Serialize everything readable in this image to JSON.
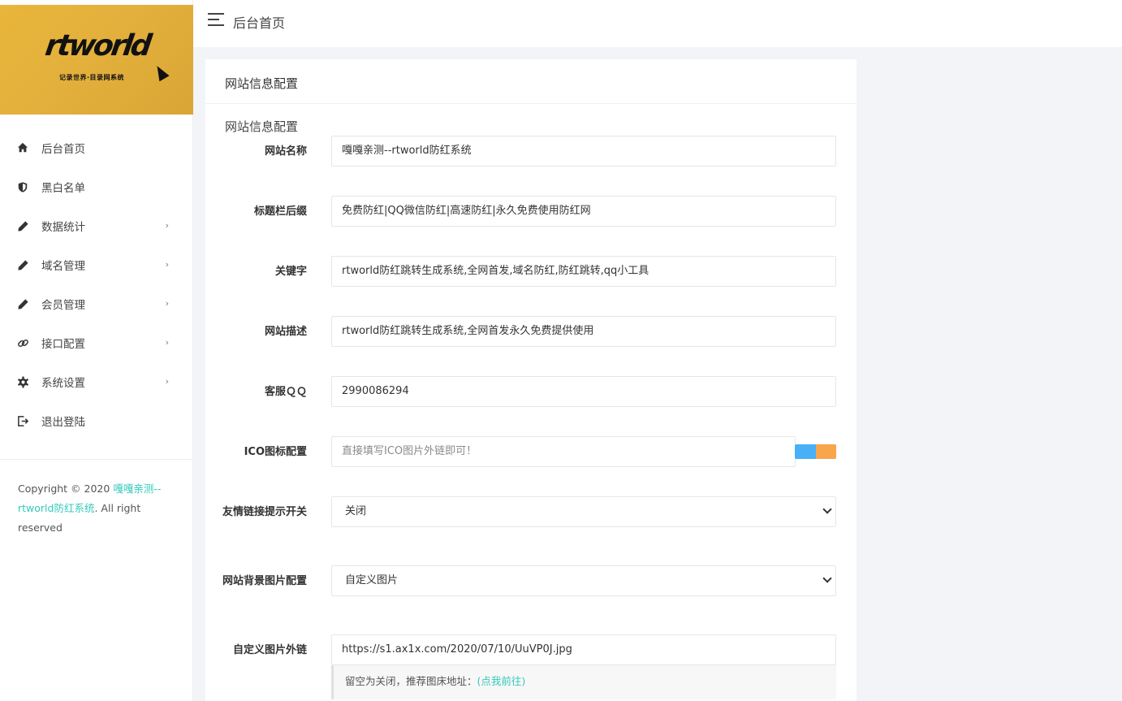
{
  "logo": {
    "title": "rtworld",
    "subtitle": "记录世界·目录网系统"
  },
  "sidebar": {
    "items": [
      {
        "label": "后台首页",
        "icon": "home-icon",
        "has_submenu": false
      },
      {
        "label": "黑白名单",
        "icon": "shield-icon",
        "has_submenu": false
      },
      {
        "label": "数据统计",
        "icon": "pencil-icon",
        "has_submenu": true
      },
      {
        "label": "域名管理",
        "icon": "pencil-icon",
        "has_submenu": true
      },
      {
        "label": "会员管理",
        "icon": "pencil-icon",
        "has_submenu": true
      },
      {
        "label": "接口配置",
        "icon": "link-icon",
        "has_submenu": true
      },
      {
        "label": "系统设置",
        "icon": "gear-icon",
        "has_submenu": true
      },
      {
        "label": "退出登陆",
        "icon": "logout-icon",
        "has_submenu": false
      }
    ],
    "copyright_prefix": "Copyright © 2020 ",
    "copyright_link": "嘎嘎亲测--rtworld防红系统",
    "copyright_suffix": ". All right reserved"
  },
  "topbar": {
    "title": "后台首页"
  },
  "card": {
    "header": "网站信息配置",
    "section_title": "网站信息配置",
    "fields": {
      "site_name": {
        "label": "网站名称",
        "value": "嘎嘎亲测--rtworld防红系统"
      },
      "title_suffix": {
        "label": "标题栏后缀",
        "value": "免费防红|QQ微信防红|高速防红|永久免费使用防红网"
      },
      "keywords": {
        "label": "关键字",
        "value": "rtworld防红跳转生成系统,全网首发,域名防红,防红跳转,qq小工具"
      },
      "description": {
        "label": "网站描述",
        "value": "rtworld防红跳转生成系统,全网首发永久免费提供使用"
      },
      "service_qq": {
        "label": "客服ＱＱ",
        "value": "2990086294"
      },
      "ico": {
        "label": "ICO图标配置",
        "placeholder": "直接填写ICO图片外链即可！"
      },
      "friend_link": {
        "label": "友情链接提示开关",
        "value": "关闭"
      },
      "bg_image": {
        "label": "网站背景图片配置",
        "value": "自定义图片"
      },
      "custom_image": {
        "label": "自定义图片外链",
        "value": "https://s1.ax1x.com/2020/07/10/UuVP0J.jpg"
      }
    },
    "help_text": "留空为关闭，推荐图床地址：",
    "help_link": "(点我前往)"
  },
  "colors": {
    "accent": "#33cabb",
    "blue_button": "#48b0f7",
    "orange_button": "#f8a54b"
  }
}
